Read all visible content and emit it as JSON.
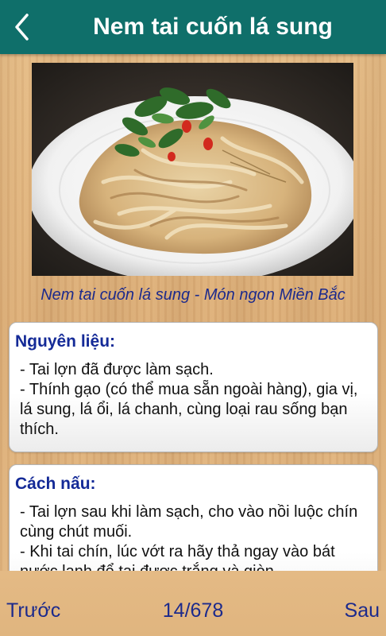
{
  "header": {
    "title": "Nem tai cuốn lá sung"
  },
  "photo": {
    "caption": "Nem tai cuốn lá sung - Món ngon Miền Bắc"
  },
  "ingredients": {
    "heading": "Nguyên liệu:",
    "lines": [
      "- Tai lợn đã được làm sạch.",
      "- Thính gạo (có thể mua sẵn ngoài hàng), gia vị, lá sung, lá ổi, lá chanh, cùng loại rau sống bạn thích."
    ]
  },
  "method": {
    "heading": "Cách nấu:",
    "lines": [
      "- Tai lợn sau khi làm sạch, cho vào nồi luộc chín cùng chút muối.",
      "- Khi tai chín, lúc vớt ra hãy thả ngay vào bát nước lạnh để tai được trắng và giòn."
    ]
  },
  "footer": {
    "prev_label": "Trước",
    "page_indicator": "14/678",
    "next_label": "Sau"
  },
  "colors": {
    "topbar": "#0f6f6a",
    "heading_text": "#142a97",
    "nav_text": "#1c2a8c"
  }
}
